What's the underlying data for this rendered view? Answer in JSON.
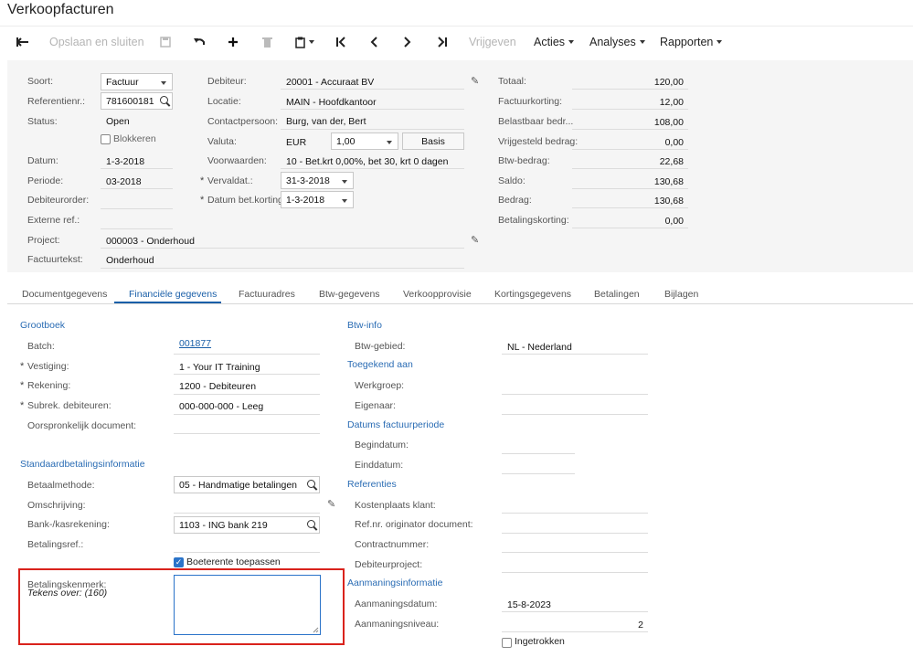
{
  "page": {
    "title": "Verkoopfacturen"
  },
  "toolbar": {
    "back_icon": "arrow-left-icon",
    "save_close": "Opslaan en sluiten",
    "release": "Vrijgeven",
    "actions": "Acties",
    "analyses": "Analyses",
    "reports": "Rapporten"
  },
  "header": {
    "soort_label": "Soort:",
    "soort_value": "Factuur",
    "ref_label": "Referentienr.:",
    "ref_value": "781600181",
    "status_label": "Status:",
    "status_value": "Open",
    "blokkeren_label": "Blokkeren",
    "datum_label": "Datum:",
    "datum_value": "1-3-2018",
    "periode_label": "Periode:",
    "periode_value": "03-2018",
    "debiteurorder_label": "Debiteurorder:",
    "externeref_label": "Externe ref.:",
    "project_label": "Project:",
    "project_value": "000003 - Onderhoud",
    "factuurtekst_label": "Factuurtekst:",
    "factuurtekst_value": "Onderhoud",
    "debiteur_label": "Debiteur:",
    "debiteur_value": "20001 - Accuraat BV",
    "locatie_label": "Locatie:",
    "locatie_value": "MAIN - Hoofdkantoor",
    "contact_label": "Contactpersoon:",
    "contact_value": "Burg, van der, Bert",
    "valuta_label": "Valuta:",
    "valuta_value": "EUR",
    "valuta_rate": "1,00",
    "valuta_basis": "Basis",
    "voorwaarden_label": "Voorwaarden:",
    "voorwaarden_value": "10 - Bet.krt 0,00%, bet 30, krt 0 dagen",
    "vervaldat_label": "Vervaldat.:",
    "vervaldat_value": "31-3-2018",
    "datumbetkort_label": "Datum bet.korting:",
    "datumbetkort_value": "1-3-2018"
  },
  "totals": [
    {
      "label": "Totaal:",
      "value": "120,00"
    },
    {
      "label": "Factuurkorting:",
      "value": "12,00"
    },
    {
      "label": "Belastbaar bedr...",
      "value": "108,00"
    },
    {
      "label": "Vrijgesteld bedrag:",
      "value": "0,00"
    },
    {
      "label": "Btw-bedrag:",
      "value": "22,68"
    },
    {
      "label": "Saldo:",
      "value": "130,68"
    },
    {
      "label": "Bedrag:",
      "value": "130,68"
    },
    {
      "label": "Betalingskorting:",
      "value": "0,00"
    }
  ],
  "tabs": [
    "Documentgegevens",
    "Financiële gegevens",
    "Factuuradres",
    "Btw-gegevens",
    "Verkoopprovisie",
    "Kortingsgegevens",
    "Betalingen",
    "Bijlagen"
  ],
  "fin": {
    "grootboek": "Grootboek",
    "batch_label": "Batch:",
    "batch_value": "001877",
    "vestiging_label": "Vestiging:",
    "vestiging_value": "1 - Your IT Training",
    "rekening_label": "Rekening:",
    "rekening_value": "1200 - Debiteuren",
    "subrek_label": "Subrek. debiteuren:",
    "subrek_value": "000-000-000 - Leeg",
    "oorspr_label": "Oorspronkelijk document:",
    "standaard": "Standaardbetalingsinformatie",
    "betaalmethode_label": "Betaalmethode:",
    "betaalmethode_value": "05 - Handmatige betalingen",
    "omschrijving_label": "Omschrijving:",
    "bank_label": "Bank-/kasrekening:",
    "bank_value": "1103 - ING bank 219",
    "betalingsref_label": "Betalingsref.:",
    "boeterente_label": "Boeterente toepassen",
    "kenmerk_label": "Betalingskenmerk:",
    "tekens_label": "Tekens over: (160)",
    "btwinfo": "Btw-info",
    "btwgebied_label": "Btw-gebied:",
    "btwgebied_value": "NL - Nederland",
    "toegekend": "Toegekend aan",
    "werkgroep_label": "Werkgroep:",
    "eigenaar_label": "Eigenaar:",
    "datums": "Datums factuurperiode",
    "begindatum_label": "Begindatum:",
    "einddatum_label": "Einddatum:",
    "referenties": "Referenties",
    "kostenplaats_label": "Kostenplaats klant:",
    "refnr_label": "Ref.nr. originator document:",
    "contractnummer_label": "Contractnummer:",
    "debiteurproject_label": "Debiteurproject:",
    "aanmaning": "Aanmaningsinformatie",
    "aanmaningsdatum_label": "Aanmaningsdatum:",
    "aanmaningsdatum_value": "15-8-2023",
    "aanmaningsniveau_label": "Aanmaningsniveau:",
    "aanmaningsniveau_value": "2",
    "ingetrokken_label": "Ingetrokken"
  },
  "colors": {
    "accent": "#1a5fa8",
    "highlight_border": "#d9221c",
    "checkbox": "#2a73c9"
  }
}
